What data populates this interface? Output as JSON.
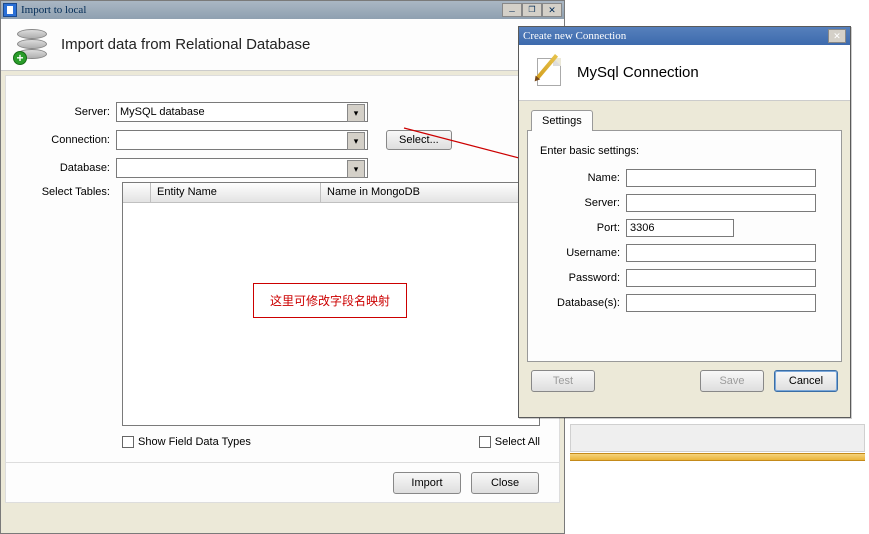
{
  "win1": {
    "title": "Import to local",
    "header": "Import data from Relational Database",
    "labels": {
      "server": "Server:",
      "connection": "Connection:",
      "database": "Database:",
      "select_tables": "Select Tables:"
    },
    "server_value": "MySQL database",
    "connection_value": "",
    "database_value": "",
    "select_btn": "Select...",
    "columns": {
      "entity": "Entity Name",
      "mongo": "Name in MongoDB"
    },
    "annotation": "这里可修改字段名映射",
    "show_types": "Show Field Data Types",
    "select_all": "Select All",
    "import_btn": "Import",
    "close_btn": "Close"
  },
  "win2": {
    "title": "Create new Connection",
    "header": "MySql Connection",
    "tab": "Settings",
    "intro": "Enter basic settings:",
    "labels": {
      "name": "Name:",
      "server": "Server:",
      "port": "Port:",
      "username": "Username:",
      "password": "Password:",
      "databases": "Database(s):"
    },
    "values": {
      "name": "",
      "server": "",
      "port": "3306",
      "username": "",
      "password": "",
      "databases": ""
    },
    "test_btn": "Test",
    "save_btn": "Save",
    "cancel_btn": "Cancel"
  }
}
